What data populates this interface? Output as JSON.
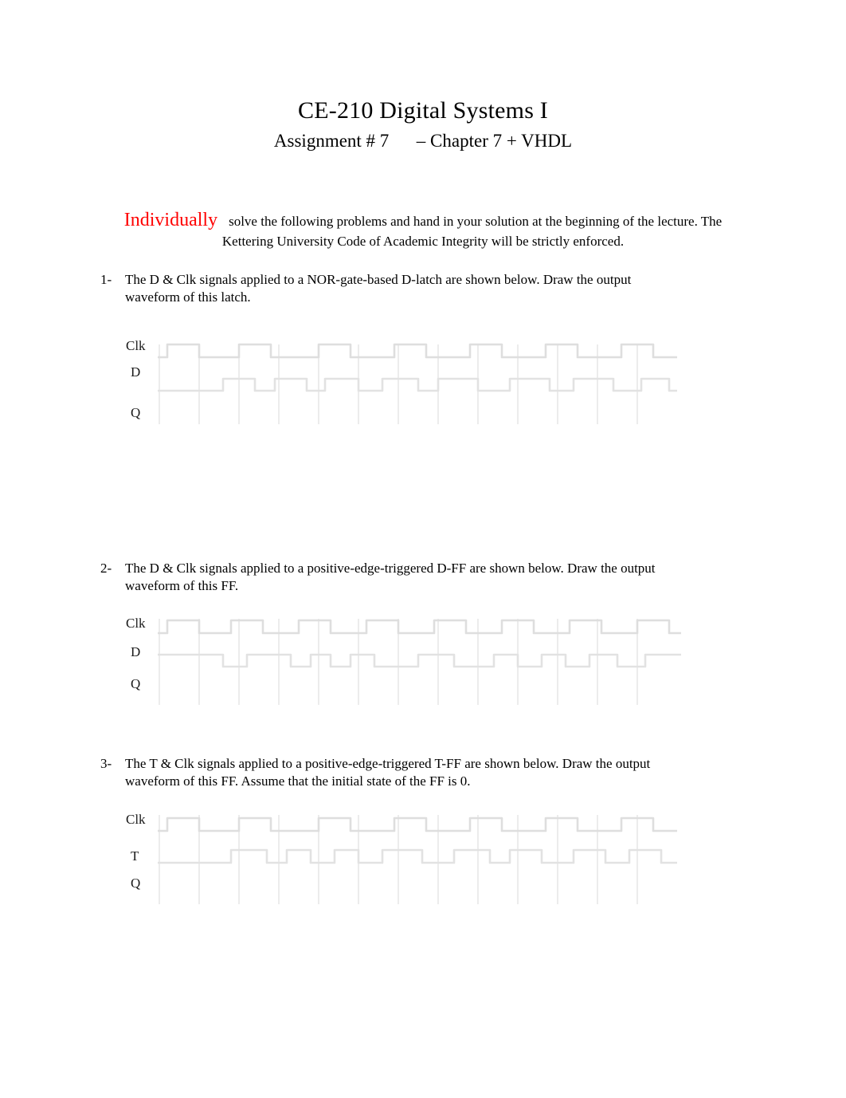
{
  "document": {
    "title": "CE-210 Digital Systems I",
    "subtitle": "Assignment # 7      – Chapter 7 + VHDL"
  },
  "intro": {
    "highlight": "Individually",
    "text": "solve the following problems and hand in your solution at the beginning of the lecture. The Kettering University Code of Academic Integrity will be strictly enforced.",
    "highlight_color": "#ff0000"
  },
  "problems": [
    {
      "number": "1-",
      "line1": "The  D  &  Clk  signals  applied  to  a  NOR-gate-based  D-latch  are  shown  below.  Draw  the  output",
      "line2": "waveform of this latch.",
      "diagram": {
        "labels": [
          "Clk",
          "D",
          "Q"
        ],
        "signals": [
          "Clk",
          "D",
          "Q"
        ],
        "appearance": "faded"
      }
    },
    {
      "number": "2-",
      "line1": "The D & Clk signals applied to a positive-edge-triggered D-FF  are shown below. Draw the output",
      "line2": "waveform of this FF.",
      "diagram": {
        "labels": [
          "Clk",
          "D",
          "Q"
        ],
        "signals": [
          "Clk",
          "D",
          "Q"
        ],
        "appearance": "faded"
      }
    },
    {
      "number": "3-",
      "line1": "The  T  &  Clk  signals  applied  to  a  positive-edge-triggered  T-FF  are  shown  below.  Draw  the  output",
      "line2": "waveform of this FF. Assume that the initial state of the FF is 0.",
      "diagram": {
        "labels": [
          "Clk",
          "T",
          "Q"
        ],
        "signals": [
          "Clk",
          "T",
          "Q"
        ],
        "appearance": "faded"
      }
    }
  ],
  "chart_data": [
    {
      "type": "line",
      "title": "Problem 1 timing diagram",
      "xlabel": "",
      "ylabel": "",
      "series": [
        {
          "name": "Clk",
          "values": [
            0,
            1,
            1,
            0,
            0,
            1,
            1,
            0,
            0,
            1,
            1,
            0,
            0,
            1,
            1,
            0,
            0,
            1,
            1,
            0,
            0,
            1,
            1,
            0,
            0,
            1,
            1,
            0
          ]
        },
        {
          "name": "D",
          "values": [
            0,
            0,
            0,
            0,
            1,
            1,
            0,
            0,
            1,
            1,
            1,
            0,
            0,
            1,
            1,
            0,
            0,
            0,
            1,
            1,
            1,
            0,
            0,
            1,
            1,
            0,
            0,
            0
          ]
        },
        {
          "name": "Q",
          "values": []
        }
      ],
      "grid": true
    },
    {
      "type": "line",
      "title": "Problem 2 timing diagram",
      "xlabel": "",
      "ylabel": "",
      "series": [
        {
          "name": "Clk",
          "values": [
            0,
            1,
            1,
            0,
            0,
            1,
            1,
            0,
            0,
            1,
            1,
            0,
            0,
            1,
            1,
            0,
            0,
            1,
            1,
            0,
            0,
            1,
            1,
            0,
            0,
            1,
            1,
            0
          ]
        },
        {
          "name": "D",
          "values": [
            1,
            1,
            0,
            0,
            1,
            0,
            1,
            0,
            1,
            1,
            1,
            0,
            0,
            0,
            1,
            1,
            0,
            1,
            0,
            1,
            0,
            1,
            1,
            0,
            0,
            1,
            1,
            1
          ]
        },
        {
          "name": "Q",
          "values": []
        }
      ],
      "grid": true
    },
    {
      "type": "line",
      "title": "Problem 3 timing diagram",
      "xlabel": "",
      "ylabel": "",
      "series": [
        {
          "name": "Clk",
          "values": [
            0,
            1,
            1,
            0,
            0,
            1,
            1,
            0,
            0,
            1,
            1,
            0,
            0,
            1,
            1,
            0,
            0,
            1,
            1,
            0,
            0,
            1,
            1,
            0,
            0,
            1,
            1,
            0
          ]
        },
        {
          "name": "T",
          "values": [
            0,
            0,
            0,
            0,
            1,
            1,
            0,
            1,
            0,
            1,
            0,
            1,
            1,
            0,
            1,
            1,
            0,
            0,
            1,
            1,
            0,
            1,
            1,
            0,
            1,
            0,
            1,
            1
          ]
        },
        {
          "name": "Q",
          "values": []
        }
      ],
      "grid": true
    }
  ]
}
